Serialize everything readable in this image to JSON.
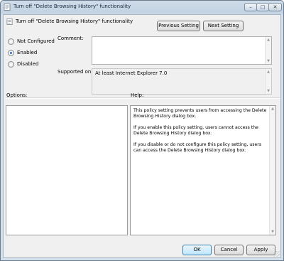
{
  "window": {
    "title": "Turn off \"Delete Browsing History\" functionality",
    "minimize_glyph": "–",
    "maximize_glyph": "□",
    "close_glyph": "✕",
    "icon": "policy-document-icon"
  },
  "header": {
    "setting_name": "Turn off \"Delete Browsing History\" functionality",
    "icon": "policy-document-icon",
    "prev_label": "Previous Setting",
    "next_label": "Next Setting"
  },
  "state_options": [
    {
      "label": "Not Configured",
      "checked": false
    },
    {
      "label": "Enabled",
      "checked": true
    },
    {
      "label": "Disabled",
      "checked": false
    }
  ],
  "comment": {
    "label": "Comment:",
    "value": ""
  },
  "supported": {
    "label": "Supported on:",
    "value": "At least Internet Explorer 7.0"
  },
  "options": {
    "label": "Options:"
  },
  "help": {
    "label": "Help:",
    "paragraphs": [
      "This policy setting prevents users from accessing the Delete Browsing History dialog box.",
      "If you enable this policy setting, users cannot access the Delete Browsing History dialog box.",
      "If you disable or do not configure this policy setting, users can access the Delete Browsing History dialog box."
    ]
  },
  "footer": {
    "ok_label": "OK",
    "cancel_label": "Cancel",
    "apply_label": "Apply"
  },
  "colors": {
    "title_bar": "#c3d3e4",
    "dialog_bg": "#f0f0f0",
    "default_button": "#bee6fd",
    "radio_dot": "#2f6cc4"
  }
}
